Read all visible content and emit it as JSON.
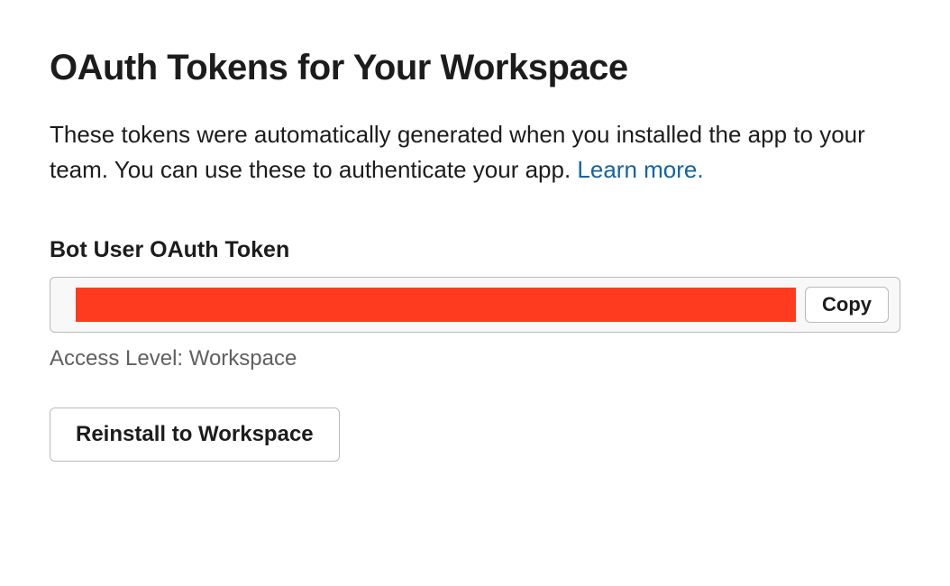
{
  "heading": "OAuth Tokens for Your Workspace",
  "description_text": "These tokens were automatically generated when you installed the app to your team. You can use these to authenticate your app. ",
  "learn_more_label": "Learn more.",
  "token_section": {
    "label": "Bot User OAuth Token",
    "copy_button_label": "Copy",
    "access_level_text": "Access Level: Workspace"
  },
  "reinstall_button_label": "Reinstall to Workspace"
}
